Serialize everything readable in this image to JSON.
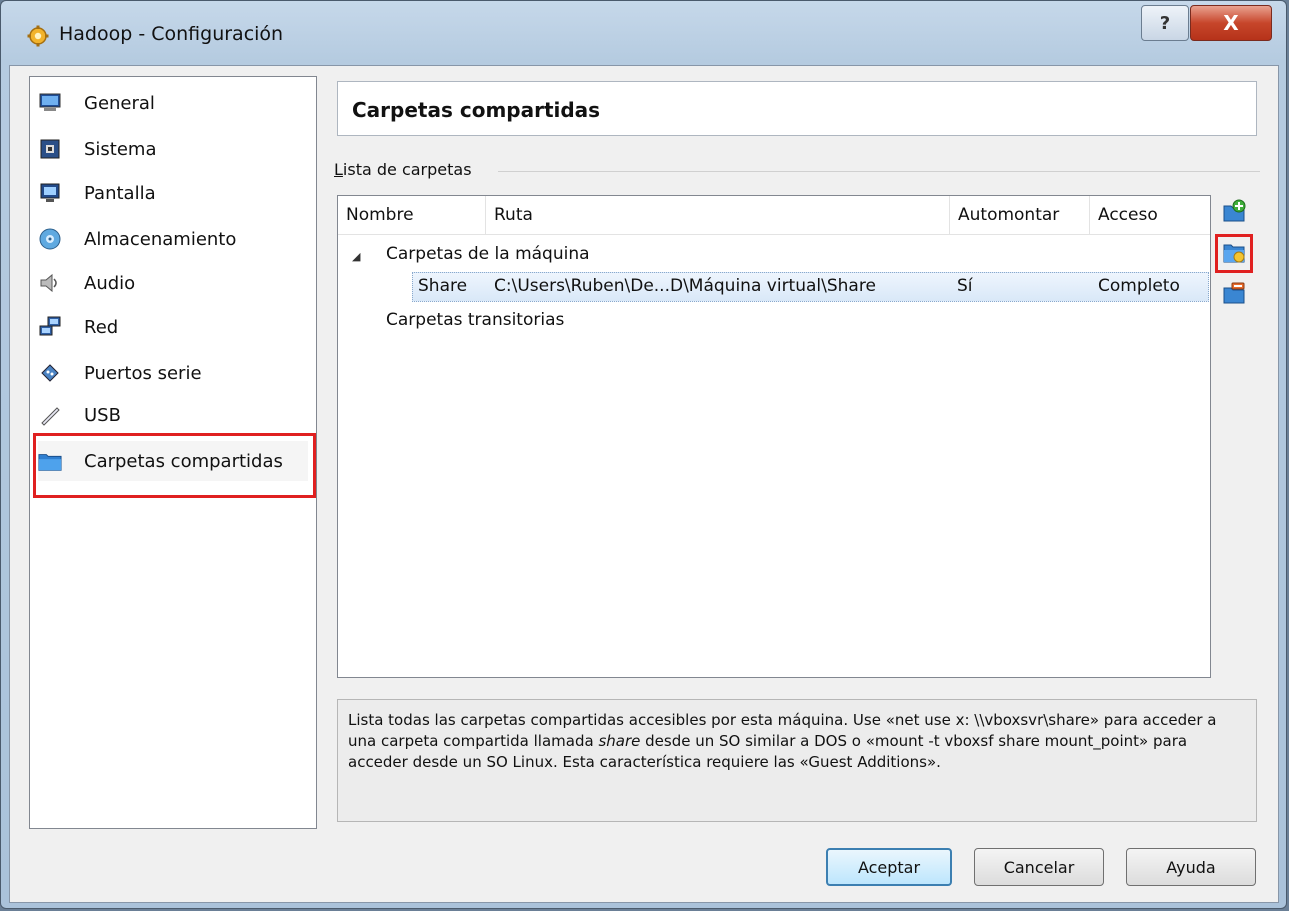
{
  "window": {
    "title": "Hadoop - Configuración",
    "help_glyph": "?",
    "close_glyph": "X"
  },
  "sidebar": {
    "items": [
      {
        "label": "General",
        "icon": "monitor-icon"
      },
      {
        "label": "Sistema",
        "icon": "motherboard-icon"
      },
      {
        "label": "Pantalla",
        "icon": "display-icon"
      },
      {
        "label": "Almacenamiento",
        "icon": "disk-icon"
      },
      {
        "label": "Audio",
        "icon": "speaker-icon"
      },
      {
        "label": "Red",
        "icon": "network-icon"
      },
      {
        "label": "Puertos serie",
        "icon": "serial-port-icon"
      },
      {
        "label": "USB",
        "icon": "usb-icon"
      },
      {
        "label": "Carpetas compartidas",
        "icon": "folder-icon",
        "selected": true
      }
    ]
  },
  "page": {
    "title": "Carpetas compartidas",
    "group_label": "Lista de carpetas"
  },
  "table": {
    "columns": [
      "Nombre",
      "Ruta",
      "Automontar",
      "Acceso"
    ],
    "groups": [
      {
        "label": "Carpetas de la máquina",
        "rows": [
          {
            "name": "Share",
            "path": "C:\\Users\\Ruben\\De...D\\Máquina virtual\\Share",
            "automount": "Sí",
            "access": "Completo"
          }
        ]
      },
      {
        "label": "Carpetas transitorias",
        "rows": []
      }
    ]
  },
  "toolbar": {
    "buttons": [
      "add-folder-icon",
      "edit-folder-icon",
      "remove-folder-icon"
    ]
  },
  "description": {
    "part1": "Lista todas las carpetas compartidas accesibles por esta máquina. Use «net use x: \\\\vboxsvr\\share» para acceder a una carpeta compartida llamada ",
    "em": "share",
    "part2": " desde un SO similar a DOS o «mount -t vboxsf share mount_point» para acceder desde un SO Linux. Esta característica requiere las «Guest Additions»."
  },
  "buttons": {
    "ok": "Aceptar",
    "cancel": "Cancelar",
    "help": "Ayuda"
  },
  "colors": {
    "highlight": "#e02020",
    "selection": "#d9e8f8"
  }
}
